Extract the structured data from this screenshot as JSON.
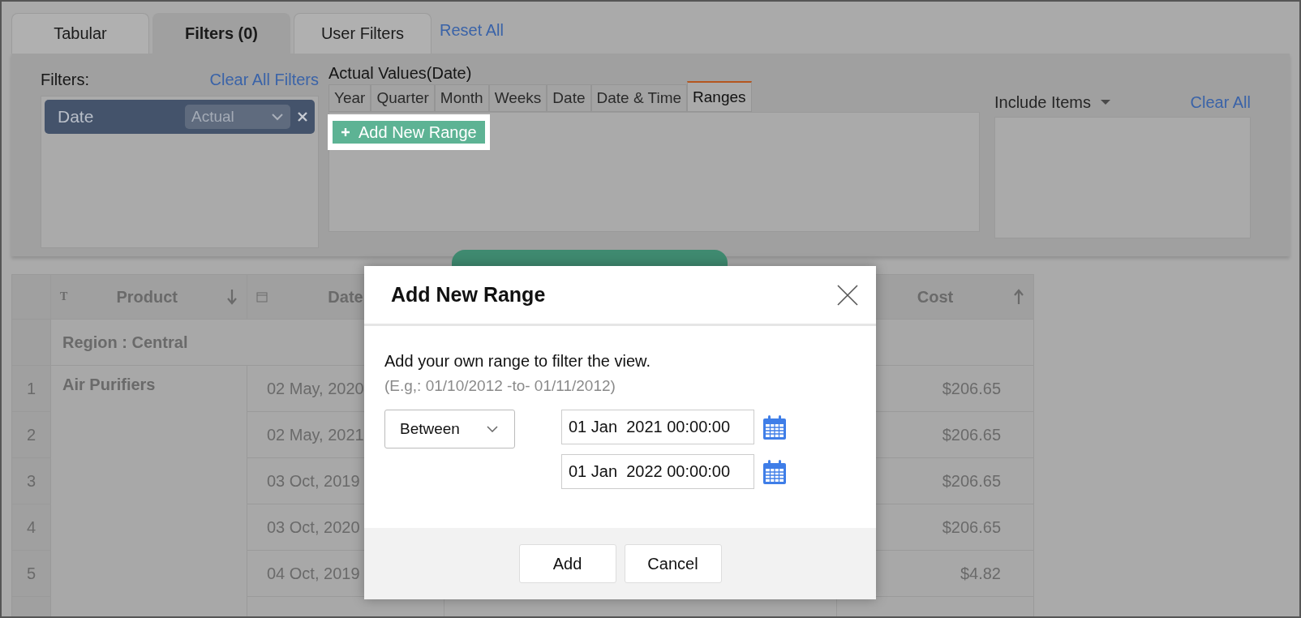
{
  "tabs": [
    {
      "label": "Tabular",
      "selected": false
    },
    {
      "label": "Filters (0)",
      "selected": true
    },
    {
      "label": "User Filters",
      "selected": false
    }
  ],
  "reset_link": "Reset All",
  "filters_panel": {
    "label": "Filters:",
    "clear_link": "Clear All Filters",
    "chips": [
      {
        "name": "Date",
        "mode": "Actual"
      }
    ]
  },
  "values_panel": {
    "title": "Actual Values(Date)",
    "tabs": [
      {
        "label": "Year",
        "selected": false
      },
      {
        "label": "Quarter",
        "selected": false
      },
      {
        "label": "Month",
        "selected": false
      },
      {
        "label": "Weeks",
        "selected": false
      },
      {
        "label": "Date",
        "selected": false
      },
      {
        "label": "Date & Time",
        "selected": false
      },
      {
        "label": "Ranges",
        "selected": true
      }
    ],
    "add_button": "Add New Range"
  },
  "include_panel": {
    "label": "Include Items",
    "clear_link": "Clear All"
  },
  "table": {
    "columns": [
      {
        "label": "Product",
        "kind": "text",
        "type_icon": "T",
        "sort_down": true
      },
      {
        "label": "Date",
        "kind": "date"
      },
      {
        "label": "Cost",
        "kind": "number",
        "sort_up": true
      }
    ],
    "group": "Region : Central",
    "items": [
      {
        "product": "Air Purifiers",
        "rows": [
          {
            "number": "1",
            "date": "02 May, 2020",
            "cost": "$206.65"
          },
          {
            "number": "2",
            "date": "02 May, 2021",
            "cost": "$206.65"
          },
          {
            "number": "3",
            "date": "03 Oct, 2019",
            "cost": "$206.65"
          },
          {
            "number": "4",
            "date": "03 Oct, 2020",
            "cost": "$206.65"
          },
          {
            "number": "5",
            "date": "04 Oct, 2019",
            "cost": "$4.82"
          }
        ]
      }
    ]
  },
  "dialog": {
    "title": "Add New Range",
    "description": "Add your own range to filter the view.",
    "example": "(E.g,: 01/10/2012 -to- 01/11/2012)",
    "operator": "Between",
    "from": "01 Jan  2021 00:00:00",
    "to": "01 Jan  2022 00:00:00",
    "buttons": [
      "Add",
      "Cancel"
    ]
  }
}
